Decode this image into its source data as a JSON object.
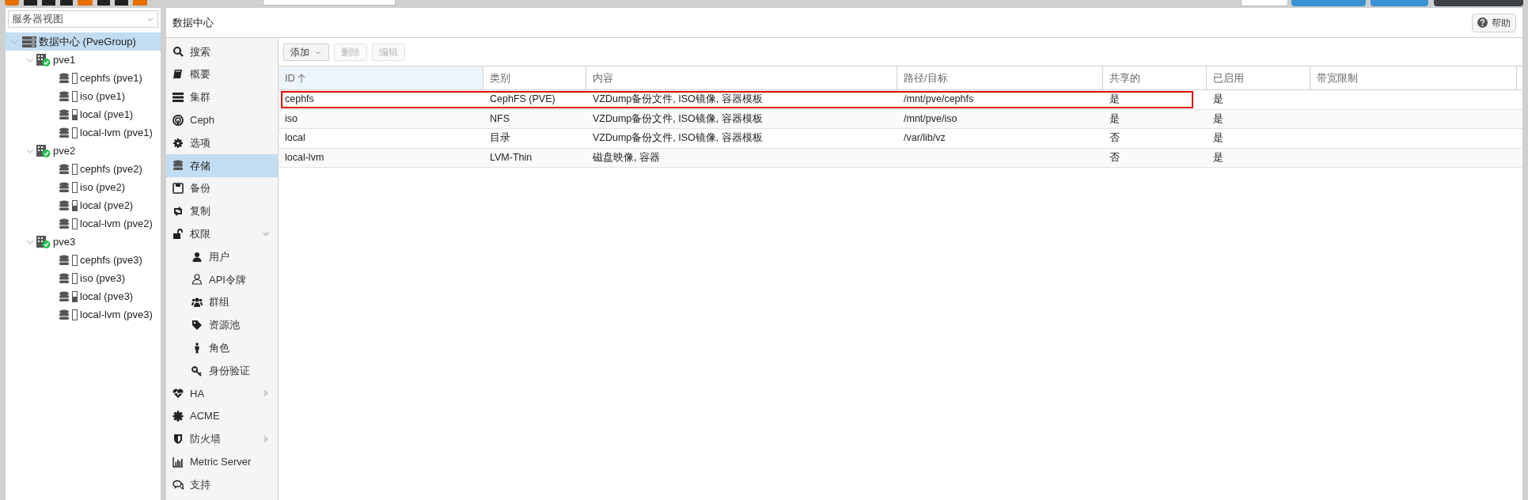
{
  "resource_view": {
    "value": "服务器视图"
  },
  "tree": [
    {
      "label": "数据中心 (PveGroup)",
      "kind": "datacenter",
      "selected": true,
      "expanded": true,
      "children": [
        {
          "label": "pve1",
          "kind": "node",
          "online": true,
          "expanded": true,
          "children": [
            {
              "label": "cephfs (pve1)",
              "kind": "storage",
              "level": 0
            },
            {
              "label": "iso (pve1)",
              "kind": "storage",
              "level": 0
            },
            {
              "label": "local (pve1)",
              "kind": "storage",
              "level": 0.5
            },
            {
              "label": "local-lvm (pve1)",
              "kind": "storage",
              "level": 0
            }
          ]
        },
        {
          "label": "pve2",
          "kind": "node",
          "online": true,
          "expanded": true,
          "children": [
            {
              "label": "cephfs (pve2)",
              "kind": "storage",
              "level": 0
            },
            {
              "label": "iso (pve2)",
              "kind": "storage",
              "level": 0
            },
            {
              "label": "local (pve2)",
              "kind": "storage",
              "level": 0.5
            },
            {
              "label": "local-lvm (pve2)",
              "kind": "storage",
              "level": 0
            }
          ]
        },
        {
          "label": "pve3",
          "kind": "node",
          "online": true,
          "expanded": true,
          "children": [
            {
              "label": "cephfs (pve3)",
              "kind": "storage",
              "level": 0
            },
            {
              "label": "iso (pve3)",
              "kind": "storage",
              "level": 0
            },
            {
              "label": "local (pve3)",
              "kind": "storage",
              "level": 0.5
            },
            {
              "label": "local-lvm (pve3)",
              "kind": "storage",
              "level": 0
            }
          ]
        }
      ]
    }
  ],
  "panel": {
    "title": "数据中心",
    "help_button": "帮助"
  },
  "nav": [
    {
      "label": "搜索",
      "selected": false
    },
    {
      "label": "概要",
      "selected": false
    },
    {
      "label": "集群",
      "selected": false
    },
    {
      "label": "Ceph",
      "selected": false
    },
    {
      "label": "选项",
      "selected": false
    },
    {
      "label": "存储",
      "selected": true
    },
    {
      "label": "备份",
      "selected": false
    },
    {
      "label": "复制",
      "selected": false
    },
    {
      "label": "权限",
      "selected": false,
      "expanded": true,
      "children": [
        {
          "label": "用户",
          "selected": false
        },
        {
          "label": "API令牌",
          "selected": false
        },
        {
          "label": "群组",
          "selected": false
        },
        {
          "label": "资源池",
          "selected": false
        },
        {
          "label": "角色",
          "selected": false
        },
        {
          "label": "身份验证",
          "selected": false
        }
      ]
    },
    {
      "label": "HA",
      "selected": false,
      "expanded": false
    },
    {
      "label": "ACME",
      "selected": false
    },
    {
      "label": "防火墙",
      "selected": false,
      "expanded": false
    },
    {
      "label": "Metric Server",
      "selected": false
    },
    {
      "label": "支持",
      "selected": false
    }
  ],
  "toolbar": [
    {
      "label": "添加",
      "disabled": false,
      "dropdown": true
    },
    {
      "label": "删除",
      "disabled": true
    },
    {
      "label": "编辑",
      "disabled": true
    }
  ],
  "table": {
    "columns": [
      {
        "label": "ID",
        "sorted": true
      },
      {
        "label": "类别",
        "sorted": false
      },
      {
        "label": "内容",
        "sorted": false
      },
      {
        "label": "路径/目标",
        "sorted": false
      },
      {
        "label": "共享的",
        "sorted": false
      },
      {
        "label": "已启用",
        "sorted": false
      },
      {
        "label": "带宽限制",
        "sorted": false
      }
    ],
    "rows": [
      {
        "outlined": true,
        "cells": [
          "cephfs",
          "CephFS (PVE)",
          "VZDump备份文件, ISO镜像, 容器模板",
          "/mnt/pve/cephfs",
          "是",
          "是"
        ]
      },
      {
        "outlined": false,
        "cells": [
          "iso",
          "NFS",
          "VZDump备份文件, ISO镜像, 容器模板",
          "/mnt/pve/iso",
          "是",
          "是"
        ]
      },
      {
        "outlined": false,
        "cells": [
          "local",
          "目录",
          "VZDump备份文件, ISO镜像, 容器模板",
          "/var/lib/vz",
          "否",
          "是"
        ]
      },
      {
        "outlined": false,
        "cells": [
          "local-lvm",
          "LVM-Thin",
          "磁盘映像, 容器",
          "",
          "否",
          "是"
        ]
      }
    ]
  }
}
